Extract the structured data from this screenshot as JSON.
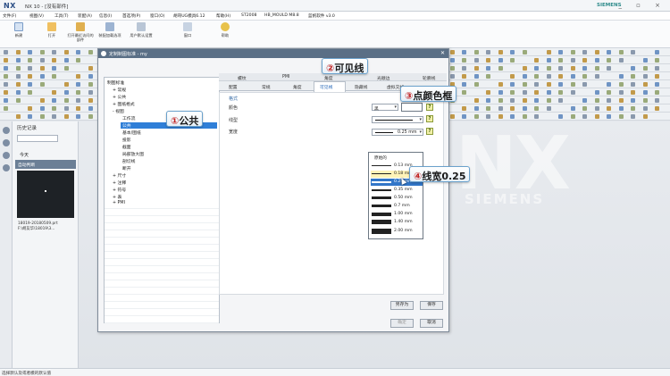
{
  "window": {
    "logo": "NX",
    "title": "NX 10 - [没有部件]",
    "brand": "SIEMENS",
    "controls": "_ ▫ ×"
  },
  "menubar": [
    "文件(F)",
    "视图(V)",
    "工具(T)",
    "装配(A)",
    "信息(I)",
    "首选项(P)",
    "窗口(O)",
    "胡哥UG模具6.12",
    "帮助(H)",
    "ST2008",
    "HB_MOULD M8.8",
    "蓝帆软件 v3.0"
  ],
  "ribbon": [
    "新建",
    "打开",
    "打开最近访问的部件",
    "装配加载选项",
    "用户默认设置",
    "窗口",
    "帮助"
  ],
  "history": {
    "title": "历史记录",
    "today": "今天",
    "auto_record": "自动判断",
    "file_line1": "18019-20180509.prt",
    "file_line2": "F:\\胡友华\\18019\\3..."
  },
  "dialog": {
    "title": "定制制图标准 - my",
    "tree": {
      "root": "制图标准",
      "items": [
        {
          "label": "+ 常规",
          "level": 1
        },
        {
          "label": "+ 公共",
          "level": 1
        },
        {
          "label": "+ 图纸格式",
          "level": 1
        },
        {
          "label": "- 视图",
          "level": 1
        },
        {
          "label": "工作流",
          "level": 2
        },
        {
          "label": "公共",
          "level": 2,
          "selected": true
        },
        {
          "label": "基本/图纸",
          "level": 2
        },
        {
          "label": "投影",
          "level": 2
        },
        {
          "label": "截面",
          "level": 2
        },
        {
          "label": "局部放大图",
          "level": 2
        },
        {
          "label": "剖切线",
          "level": 2
        },
        {
          "label": "断开",
          "level": 2
        },
        {
          "label": "+ 尺寸",
          "level": 1
        },
        {
          "label": "+ 注释",
          "level": 1
        },
        {
          "label": "+ 符号",
          "level": 1
        },
        {
          "label": "+ 表",
          "level": 1
        },
        {
          "label": "+ PMI",
          "level": 1
        }
      ]
    },
    "tabs_row1": [
      "螺纹",
      "PMI",
      "角度",
      "光顺边",
      "轮廓线"
    ],
    "tabs_row2": [
      "配置",
      "常规",
      "角度",
      "可见线",
      "隐藏线",
      "虚拟交线"
    ],
    "active_tab": "可见线",
    "section_label": "格式",
    "color_label": "颜色",
    "linetype_label": "线型",
    "width_label": "宽度",
    "color_value": "黑",
    "width_value": "0.25 mm",
    "width_options": [
      "原始的",
      "0.13 mm",
      "0.18 mm",
      "0.25 mm",
      "0.35 mm",
      "0.50 mm",
      "0.7 mm",
      "1.00 mm",
      "1.40 mm",
      "2.00 mm"
    ],
    "width_selected": "0.25 mm",
    "help_glyph": "?",
    "buttons": {
      "save_as": "另存为",
      "save": "保存",
      "apply": "确定",
      "cancel": "取消"
    }
  },
  "callouts": [
    {
      "num": "①",
      "text": "公共"
    },
    {
      "num": "②",
      "text": "可见线"
    },
    {
      "num": "③",
      "text": "点颜色框"
    },
    {
      "num": "④",
      "text": "线宽0.25"
    }
  ],
  "watermark": {
    "main": "NX",
    "sub": "SIEMENS"
  },
  "statusbar": {
    "text": "选择默认及或者模的默认值"
  },
  "colors": {
    "accent": "#2f7fd8",
    "title_bar": "#5a6f86",
    "callout_border": "#6aa1cc"
  }
}
